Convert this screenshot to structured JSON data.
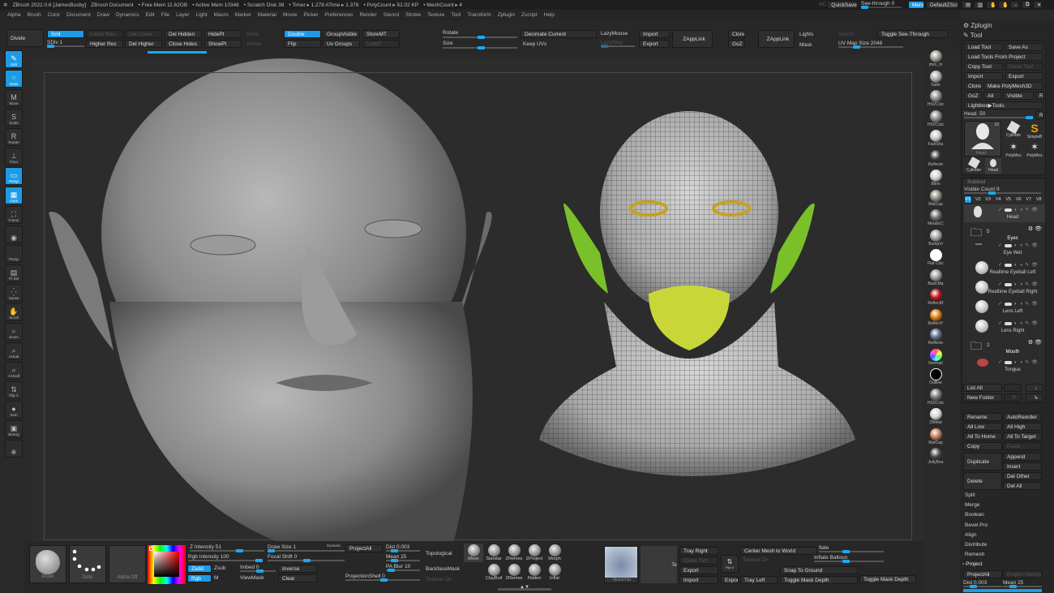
{
  "titlebar": {
    "app": "ZBrush 2022.0.6 [JamesBusby]",
    "doc": "ZBrush Document",
    "free_mem": "• Free Mem 11.62GB",
    "active_mem": "• Active Mem 10348",
    "scratch": "• Scratch Disk 38",
    "timer": "• Timer ▸ 1.278 ATime ▸ 1.378",
    "polycount": "• PolyCount ▸ 52.02 KP",
    "meshcount": "• MeshCount ▸ 4",
    "ac": "AC",
    "quicksave": "QuickSave",
    "seethrough": "See-through  0",
    "menus": "Menus",
    "defaultzscript": "DefaultZScript"
  },
  "menus": [
    "Alpha",
    "Brush",
    "Color",
    "Document",
    "Draw",
    "Dynamics",
    "Edit",
    "File",
    "Layer",
    "Light",
    "Macro",
    "Marker",
    "Material",
    "Movie",
    "Picker",
    "Preferences",
    "Render",
    "Stencil",
    "Stroke",
    "Texture",
    "Tool",
    "Transform",
    "Zplugin",
    "Zscript",
    "Help"
  ],
  "topshelf": {
    "divide": "Divide",
    "smt": "Smt",
    "sdiv": "SDiv 1",
    "lower_res": "Lower Res",
    "higher_res": "Higher Res",
    "del_lower": "Del Lower",
    "del_higher": "Del Higher",
    "del_hidden": "Del Hidden",
    "close_holes": "Close Holes",
    "hidept": "HidePt",
    "showpt": "ShowPt",
    "grow": "Grow",
    "shrink": "Shrink",
    "double": "Double",
    "flip": "Flip",
    "groupvisible": "GroupVisible",
    "uv_groups": "Uv Groups",
    "storemt": "StoreMT",
    "delmt": "DelMT",
    "rotate": "Rotate",
    "size": "Size",
    "decimate_current": "Decimate Current",
    "keep_uvs": "Keep UVs",
    "lazymouse": "LazyMouse",
    "lazystep": "LazyStep",
    "import": "Import",
    "export": "Export",
    "zapplink1": "ZAppLink",
    "clone": "Clone",
    "goz": "GoZ",
    "zapplink2": "ZAppLink",
    "lights": "Lights",
    "mask": "Mask",
    "switch": "Switch",
    "toggle_see_through": "Toggle See-Through",
    "uv_map_size": "UV Map Size 2048"
  },
  "lefttools": [
    {
      "label": "Edit",
      "icon": "✎",
      "on": true
    },
    {
      "label": "Draw",
      "icon": "⁘",
      "on": true
    },
    {
      "label": "Move",
      "icon": "M"
    },
    {
      "label": "Scale",
      "icon": "S"
    },
    {
      "label": "Rotate",
      "icon": "R"
    },
    {
      "label": "Floor",
      "icon": "⊥"
    },
    {
      "label": "Persp",
      "icon": "▭",
      "on": true
    },
    {
      "label": "Lsym",
      "icon": "▦",
      "on": true
    },
    {
      "label": "Frame",
      "icon": "⛶"
    },
    {
      "label": "",
      "icon": "◉"
    },
    {
      "label": "Persp",
      "icon": ""
    },
    {
      "label": "Pt Sel",
      "icon": "▤"
    },
    {
      "label": "Xpose",
      "icon": "⁛"
    },
    {
      "label": "Scroll",
      "icon": "✋"
    },
    {
      "label": "Zoom",
      "icon": "⌕"
    },
    {
      "label": "Actual",
      "icon": "⌕"
    },
    {
      "label": "AAHalf",
      "icon": "⌕"
    },
    {
      "label": "Flip V",
      "icon": "⇅"
    },
    {
      "label": "Sem",
      "icon": "●"
    },
    {
      "label": "Bmerg",
      "icon": "▣"
    },
    {
      "label": "",
      "icon": "⎈"
    }
  ],
  "materials": [
    {
      "name": "zbro_m",
      "color": "#9a9a90"
    },
    {
      "name": "Satin",
      "color": "#a8a8a8"
    },
    {
      "name": "HSVColc",
      "color": "#8a8a8a"
    },
    {
      "name": "HSVColc",
      "color": "#888"
    },
    {
      "name": "FastSha",
      "color": "#c8c8c8"
    },
    {
      "name": "Reflecte",
      "color": "#3a3a3a"
    },
    {
      "name": "Blinn",
      "color": "#d0d0d0"
    },
    {
      "name": "MatCap",
      "color": "#8c8a78"
    },
    {
      "name": "MetalicC",
      "color": "#6a6a6a"
    },
    {
      "name": "BumpVi",
      "color": "#a0a0a0"
    },
    {
      "name": "Flat Colc",
      "color": "#ffffff"
    },
    {
      "name": "BasicMa",
      "color": "#9a9a9a"
    },
    {
      "name": "ReflectR",
      "color": "#c0171c"
    },
    {
      "name": "ReflectY",
      "color": "#d87a10"
    },
    {
      "name": "Reflecte",
      "color": "#5a6e88"
    },
    {
      "name": "NormalI",
      "color": "#b06ad0"
    },
    {
      "name": "Outline",
      "color": "#000000"
    },
    {
      "name": "HSVColc",
      "color": "#777"
    },
    {
      "name": "ZMetal",
      "color": "#d8d8d8"
    },
    {
      "name": "MatCap",
      "color": "#c07a58"
    },
    {
      "name": "JellyBea",
      "color": "#4a4a4a"
    }
  ],
  "rightpanel": {
    "zplugin": "Zplugin",
    "tool": "Tool",
    "load_tool": "Load Tool",
    "save_as": "Save As",
    "load_tools_from_project": "Load Tools From Project",
    "copy_tool": "Copy Tool",
    "paste_tool": "Paste Tool",
    "import": "Import",
    "export": "Export",
    "clone": "Clone",
    "make_polymesh3d": "Make PolyMesh3D",
    "goz": "GoZ",
    "all": "All",
    "visible": "Visible",
    "r": "R",
    "lightbox_tools": "Lightbox▶Tools",
    "head_slider": "Head. 50",
    "thumbs": [
      {
        "name": "Head",
        "badge": "10"
      },
      {
        "name": "Cylinder"
      },
      {
        "name": "SimpleB"
      },
      {
        "name": "PolyMes"
      },
      {
        "name": "PolyMes"
      },
      {
        "name": "Cylinder"
      },
      {
        "name": "Head",
        "badge": "10"
      }
    ],
    "subtool": "Subtool",
    "visible_count": "Visible Count 9",
    "versions": [
      "V1",
      "V2",
      "V3",
      "V4",
      "V5",
      "V6",
      "V7",
      "V8"
    ],
    "subtools": [
      {
        "name": "Head",
        "kind": "head"
      },
      {
        "name": "Eyes",
        "kind": "folder",
        "count": "5"
      },
      {
        "name": "Eye Wet",
        "kind": "item"
      },
      {
        "name": "Realtime Eyeball Left",
        "kind": "ball"
      },
      {
        "name": "Realtime Eyeball Right",
        "kind": "ball"
      },
      {
        "name": "Lens Left",
        "kind": "ball"
      },
      {
        "name": "Lens Right",
        "kind": "ball"
      },
      {
        "name": "Mouth",
        "kind": "folder",
        "count": "2"
      },
      {
        "name": "Tongue",
        "kind": "tongue"
      }
    ],
    "list_all": "List All",
    "new_folder": "New Folder",
    "rename": "Rename",
    "autoreorder": "AutoReorder",
    "all_low": "All Low",
    "all_high": "All High",
    "all_to_home": "All To Home",
    "all_to_target": "All To Target",
    "copy": "Copy",
    "paste": "Paste",
    "duplicate": "Duplicate",
    "append": "Append",
    "insert": "Insert",
    "delete": "Delete",
    "del_other": "Del Other",
    "del_all": "Del All",
    "sections": [
      "Split",
      "Merge",
      "Boolean",
      "Bevel Pro",
      "Align",
      "Distribute",
      "Remesh"
    ],
    "project": "Project",
    "projectall": "ProjectAll",
    "project_history": "Project History",
    "dist": "Dist 0.003",
    "mean": "Mean 25"
  },
  "bottom": {
    "brush": "Move",
    "stroke": "Dots",
    "alpha": "Alpha Off",
    "z_intensity": "Z Intensity 51",
    "rgb_intensity": "Rgb Intensity 100",
    "zadd": "Zadd",
    "zsub": "Zsub",
    "rgb": "Rgb",
    "m": "M",
    "draw_size": "Draw Size 1",
    "dynamic": "Dynamic",
    "focal_shift": "Focal Shift 0",
    "imbed": "Imbed 0",
    "viewmask": "ViewMask",
    "inverse": "Inverse",
    "clear": "Clear",
    "projectall": "ProjectAll",
    "dist": "Dist 0.003",
    "mean": "Mean 25",
    "pa_blur": "PA Blur 10",
    "projectionshell": "ProjectionShell 0",
    "topological": "Topological",
    "backfacemask": "BackfaceMask",
    "texture_on": "Texture On",
    "brushes": [
      "Move",
      "Standar",
      "ZRemes",
      "ZProject",
      "Morph",
      "ClayBuil",
      "ZRemes",
      "Flatten",
      "Inflat"
    ],
    "brushtxtr": "~BrushTxtr",
    "te": "Te",
    "tray_right": "Tray Right",
    "clone_txtr": "Clone Txtr",
    "export": "Export",
    "import": "Import",
    "flip_v": "Flip V",
    "export2": "Export",
    "tray_left": "Tray Left",
    "center_mesh": "Center Mesh to World",
    "texture_on2": "Texture On",
    "snap_to_ground": "Snap To Ground",
    "toggle_mask_depth": "Toggle Mask Depth",
    "inflate": "flate",
    "inflate_balloon": "Inflate Balloon",
    "toggle_mask_depth2": "Toggle Mask Depth"
  }
}
